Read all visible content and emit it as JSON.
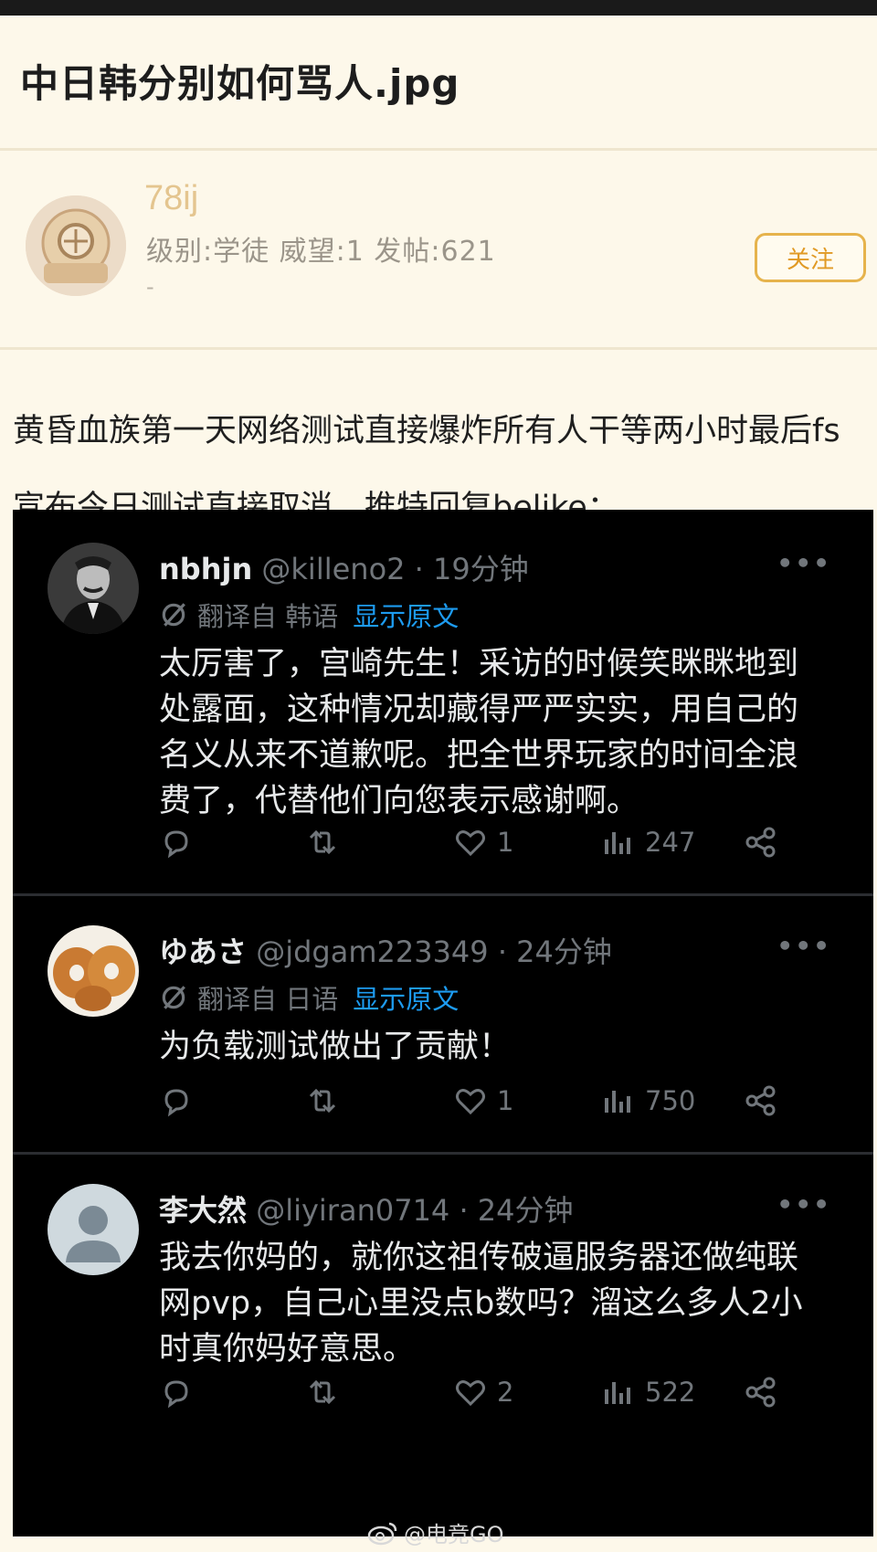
{
  "post_title": "中日韩分别如何骂人.jpg",
  "author": {
    "username": "78ij",
    "info": "级别:学徒  威望:1 发帖:621",
    "extra": "-",
    "follow_label": "关注"
  },
  "post_text": "黄昏血族第一天网络测试直接爆炸所有人干等两小时最后fs宣布今日测试直接取消，推特回复belike：",
  "tweets": [
    {
      "name": "nbhjn",
      "handle": "@killeno2",
      "time": "· 19分钟",
      "more": "•••",
      "translated_from": "翻译自 韩语",
      "show_original": "显示原文",
      "text": "太厉害了，宫崎先生！采访的时候笑眯眯地到处露面，这种情况却藏得严严实实，用自己的名义从来不道歉呢。把全世界玩家的时间全浪费了，代替他们向您表示感谢啊。",
      "likes": "1",
      "views": "247"
    },
    {
      "name": "ゆあさ",
      "handle": "@jdgam223349",
      "time": "· 24分钟",
      "more": "•••",
      "translated_from": "翻译自 日语",
      "show_original": "显示原文",
      "text": "为负载测试做出了贡献！",
      "likes": "1",
      "views": "750"
    },
    {
      "name": "李大然",
      "handle": "@liyiran0714",
      "time": "· 24分钟",
      "more": "•••",
      "text": "我去你妈的，就你这祖传破逼服务器还做纯联网pvp，自己心里没点b数吗？溜这么多人2小时真你妈好意思。",
      "likes": "2",
      "views": "522"
    }
  ],
  "watermark": "@电竞GO",
  "colors": {
    "page_bg": "#fdf8ea",
    "username": "#e4c58f",
    "follow": "#e6b34c",
    "tweet_bg": "#000000",
    "link_blue": "#1d9bf0"
  }
}
